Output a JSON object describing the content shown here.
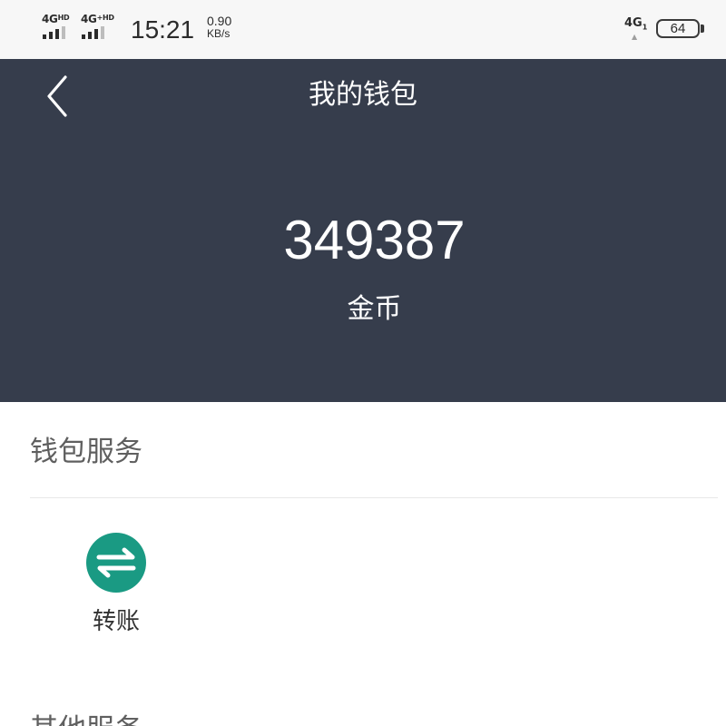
{
  "status_bar": {
    "sim1_network": "4G",
    "sim1_suffix": "HD",
    "sim2_network": "4G",
    "sim2_suffix": "+HD",
    "time": "15:21",
    "speed_value": "0.90",
    "speed_unit": "KB/s",
    "data_network": "4G",
    "data_suffix": "1",
    "battery_level": "64"
  },
  "header": {
    "back_icon": "chevron-left-icon",
    "title": "我的钱包",
    "background_color": "#363d4c"
  },
  "balance": {
    "amount": "349387",
    "unit": "金币"
  },
  "wallet_services": {
    "title": "钱包服务",
    "items": [
      {
        "label": "转账",
        "icon": "transfer-arrows-icon",
        "icon_color": "#1a9a83"
      }
    ]
  },
  "other_services": {
    "title": "其他服务"
  }
}
